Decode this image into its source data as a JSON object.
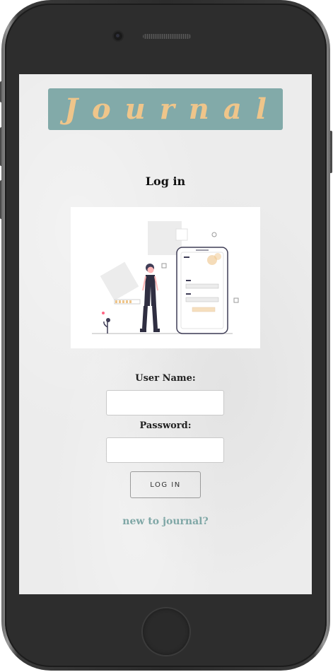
{
  "app": {
    "banner_title": "Journal"
  },
  "login": {
    "heading": "Log in",
    "username_label": "User Name:",
    "username_value": "",
    "password_label": "Password:",
    "password_value": "",
    "submit_label": "LOG IN",
    "signup_link": "new to journal?"
  },
  "colors": {
    "banner_bg": "#82aaa9",
    "banner_text": "#efc58a",
    "link": "#7fa7a6",
    "screen_bg": "#ececec"
  },
  "illustration": {
    "icon": "woman-with-phone-login-illustration"
  }
}
